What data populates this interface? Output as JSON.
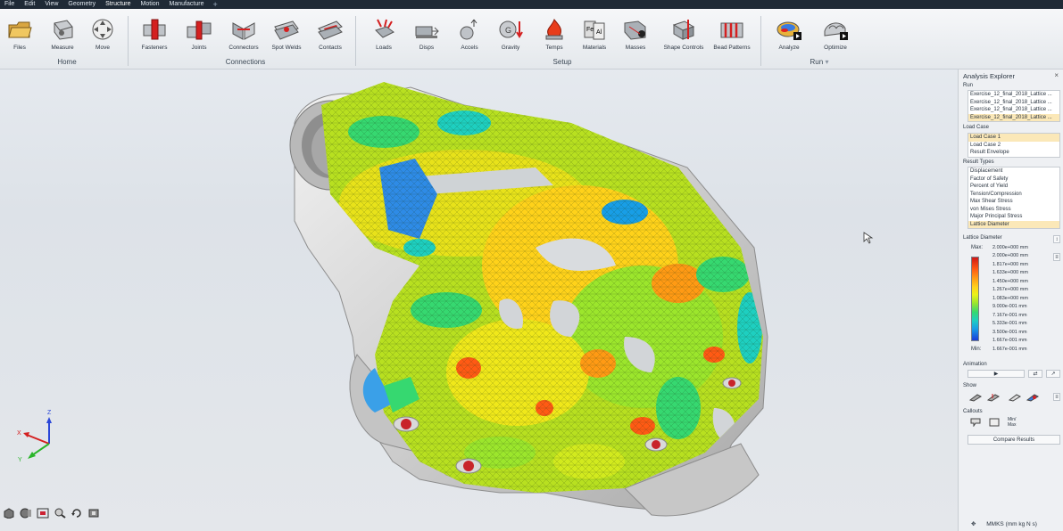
{
  "menu": {
    "items": [
      "File",
      "Edit",
      "View",
      "Geometry",
      "Structure",
      "Motion",
      "Manufacture"
    ],
    "active": "Structure",
    "add_icon": "plus-icon"
  },
  "ribbon": {
    "home": {
      "group": "Home",
      "files": "Files",
      "measure": "Measure",
      "move": "Move"
    },
    "connections": {
      "group": "Connections",
      "fasteners": "Fasteners",
      "joints": "Joints",
      "connectors": "Connectors",
      "spot_welds": "Spot Welds",
      "contacts": "Contacts"
    },
    "setup": {
      "group": "Setup",
      "loads": "Loads",
      "disps": "Disps",
      "accels": "Accels",
      "gravity": "Gravity",
      "temps": "Temps",
      "materials": "Materials",
      "masses": "Masses",
      "shape_controls": "Shape Controls",
      "bead_patterns": "Bead Patterns"
    },
    "run": {
      "group": "Run",
      "analyze": "Analyze",
      "optimize": "Optimize",
      "dropdown": "▾"
    }
  },
  "panel": {
    "title": "Analysis Explorer",
    "close": "×",
    "run_label": "Run",
    "runs": [
      "Exercise_12_final_2018_Lattice ...",
      "Exercise_12_final_2018_Lattice ...",
      "Exercise_12_final_2018_Lattice ...",
      "Exercise_12_final_2018_Lattice ..."
    ],
    "load_case_label": "Load Case",
    "load_cases": [
      "Load Case 1",
      "Load Case 2",
      "Result Envelope"
    ],
    "result_types_label": "Result Types",
    "result_types": [
      "Displacement",
      "Factor of Safety",
      "Percent of Yield",
      "Tension/Compression",
      "Max Shear Stress",
      "von Mises Stress",
      "Major Principal Stress",
      "Lattice Diameter"
    ],
    "legend_title": "Lattice Diameter",
    "legend_max_label": "Max:",
    "legend_max": "2.000e+000 mm",
    "legend_values": [
      "2.000e+000 mm",
      "1.817e+000 mm",
      "1.633e+000 mm",
      "1.450e+000 mm",
      "1.267e+000 mm",
      "1.083e+000 mm",
      "9.000e-001 mm",
      "7.167e-001 mm",
      "5.333e-001 mm",
      "3.500e-001 mm",
      "1.667e-001 mm"
    ],
    "legend_min_label": "Min:",
    "legend_min": "1.667e-001 mm",
    "animation_label": "Animation",
    "play": "▶",
    "show_label": "Show",
    "callouts_label": "Callouts",
    "minmax": "Min/\nMax",
    "compare": "Compare Results"
  },
  "units": "MMKS (mm kg N s)",
  "triad": {
    "x": "X",
    "y": "Y",
    "z": "Z"
  },
  "colors": {
    "accent": "#f0b400",
    "selected": "#fbe8b8",
    "menubar": "#1f2a36"
  }
}
